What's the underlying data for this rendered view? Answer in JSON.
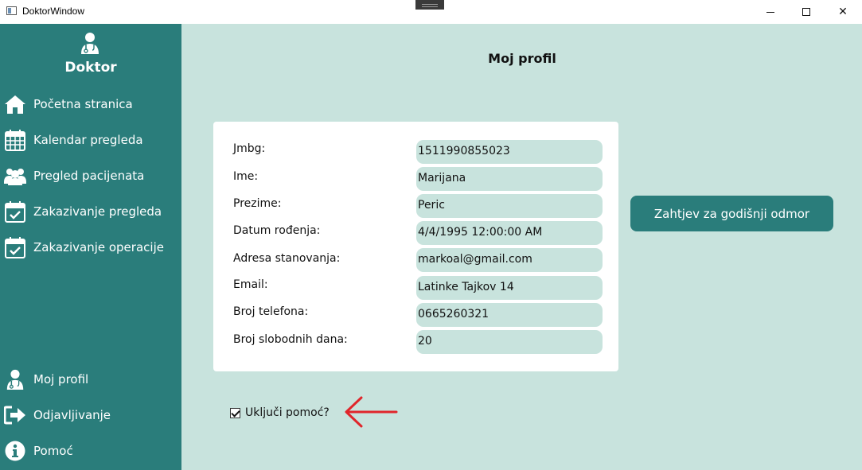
{
  "window": {
    "title": "DoktorWindow",
    "controls": {
      "minimize": "minimize",
      "maximize": "maximize",
      "close": "✕"
    }
  },
  "sidebar": {
    "role": "Doktor",
    "items": [
      {
        "label": "Početna stranica",
        "icon": "home-icon"
      },
      {
        "label": "Kalendar pregleda",
        "icon": "calendar-icon"
      },
      {
        "label": "Pregled pacijenata",
        "icon": "patients-icon"
      },
      {
        "label": "Zakazivanje pregleda",
        "icon": "calendar-check-icon"
      },
      {
        "label": "Zakazivanje operacije",
        "icon": "calendar-check-icon"
      }
    ],
    "bottom_items": [
      {
        "label": "Moj profil",
        "icon": "doctor-icon"
      },
      {
        "label": "Odjavljivanje",
        "icon": "sign-out-icon"
      },
      {
        "label": "Pomoć",
        "icon": "info-icon"
      }
    ]
  },
  "main": {
    "title": "Moj profil",
    "fields": [
      {
        "label": "Jmbg:",
        "value": "1511990855023"
      },
      {
        "label": "Ime:",
        "value": "Marijana"
      },
      {
        "label": "Prezime:",
        "value": "Peric"
      },
      {
        "label": "Datum rođenja:",
        "value": "4/4/1995 12:00:00 AM"
      },
      {
        "label": "Adresa stanovanja:",
        "value": "markoal@gmail.com"
      },
      {
        "label": "Email:",
        "value": "Latinke Tajkov 14"
      },
      {
        "label": "Broj telefona:",
        "value": "0665260321"
      },
      {
        "label": "Broj slobodnih dana:",
        "value": "20"
      }
    ],
    "vacation_button": "Zahtjev za godišnji odmor",
    "help_checkbox": {
      "label": "Uključi pomoć?",
      "checked": true
    }
  },
  "colors": {
    "sidebar": "#2a7d7b",
    "background": "#c8e3dd",
    "card": "#ffffff",
    "arrow": "#e0262b"
  }
}
